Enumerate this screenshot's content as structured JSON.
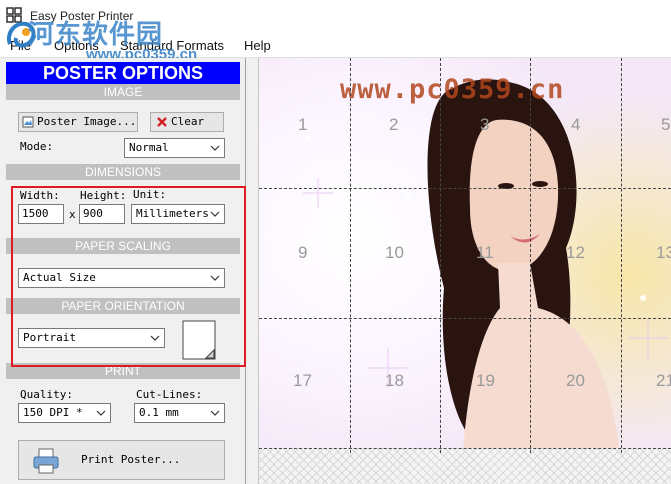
{
  "window": {
    "title": "Easy Poster Printer"
  },
  "watermark": {
    "text": "河东软件园",
    "url": "www.pc0359.cn"
  },
  "menu": [
    "File",
    "Options",
    "Standard Formats",
    "Help"
  ],
  "panel": {
    "header": "POSTER OPTIONS",
    "image_section": "IMAGE",
    "poster_image_button": "Poster Image...",
    "clear_button": "Clear",
    "mode_label": "Mode:",
    "mode_value": "Normal",
    "dimensions_section": "DIMENSIONS",
    "width_label": "Width:",
    "height_label": "Height:",
    "unit_label": "Unit:",
    "width_value": "1500",
    "height_value": "900",
    "times_sign": "x",
    "unit_value": "Millimeters",
    "scaling_section": "PAPER SCALING",
    "scaling_value": "Actual Size",
    "orientation_section": "PAPER ORIENTATION",
    "orientation_value": "Portrait",
    "print_section": "PRINT",
    "quality_label": "Quality:",
    "quality_value": "150 DPI *",
    "cutlines_label": "Cut-Lines:",
    "cutlines_value": "0.1 mm",
    "print_button": "Print Poster..."
  },
  "canvas": {
    "watermark": "www.pc0359.cn",
    "row1": [
      "1",
      "2",
      "3",
      "4",
      "5"
    ],
    "row2": [
      "9",
      "10",
      "11",
      "12",
      "13"
    ],
    "row3": [
      "17",
      "18",
      "19",
      "20",
      "21"
    ]
  },
  "colors": {
    "header_blue": "#0000ff",
    "highlight_red": "#e01a22",
    "section_gray": "#c0c0c0"
  }
}
